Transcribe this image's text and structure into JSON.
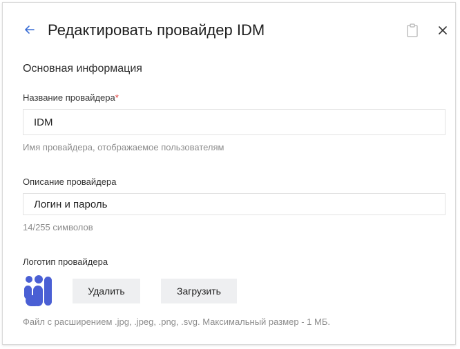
{
  "header": {
    "title": "Редактировать провайдер IDM",
    "back_icon": "arrow-left-icon",
    "clipboard_icon": "clipboard-icon",
    "close_icon": "close-icon",
    "accent_color": "#3b6fd6"
  },
  "section": {
    "title": "Основная информация"
  },
  "fields": {
    "name": {
      "label": "Название провайдера",
      "required_mark": "*",
      "value": "IDM",
      "hint": "Имя провайдера, отображаемое пользователям"
    },
    "description": {
      "label": "Описание провайдера",
      "value": "Логин и пароль",
      "counter": "14/255 символов"
    },
    "logo": {
      "label": "Логотип провайдера",
      "icon": "provider-logo-icon",
      "delete_label": "Удалить",
      "upload_label": "Загрузить",
      "hint": "Файл с расширением .jpg, .jpeg, .png, .svg. Максимальный размер - 1 МБ."
    }
  }
}
